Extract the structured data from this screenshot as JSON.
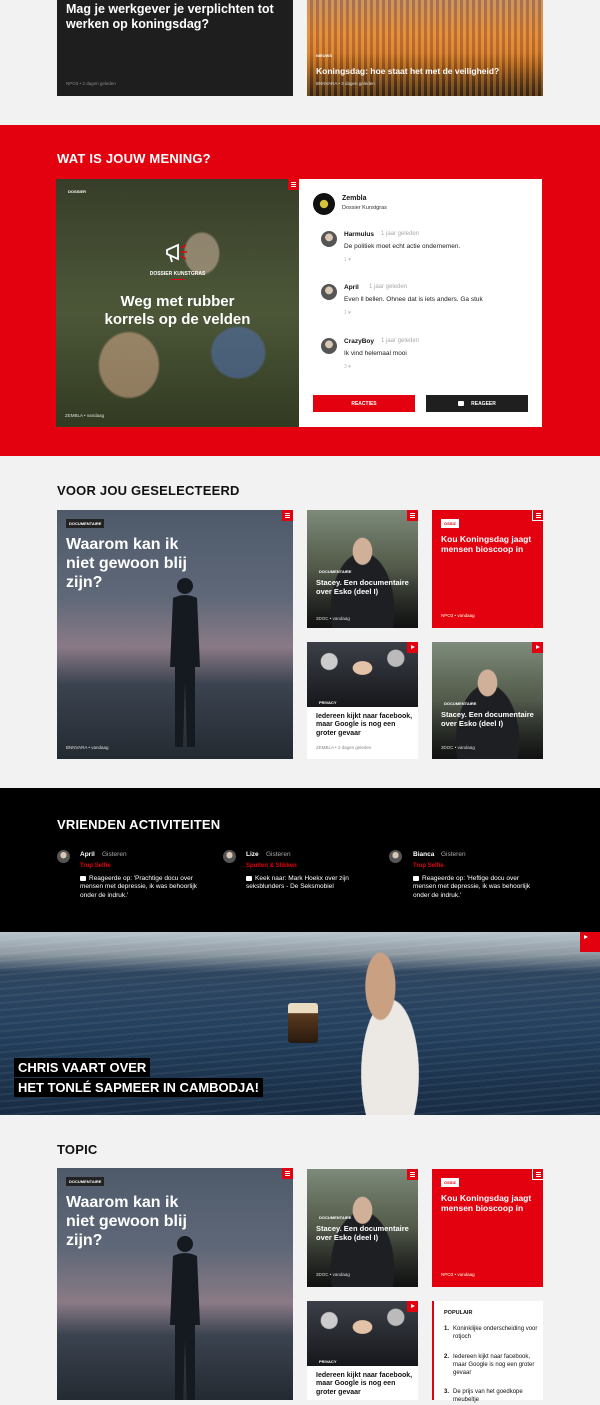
{
  "top": {
    "card1": {
      "title": "Mag je werkgever je verplichten tot werken op koningsdag?",
      "meta": "NPO3 • 2 dagen geleden"
    },
    "card2": {
      "badge": "NIEUWS",
      "title": "Koningsdag: hoe staat het met de veiligheid?",
      "meta": "BNNVARA • 3 dagen geleden"
    }
  },
  "opinion": {
    "heading": "WAT IS JOUW MENING?",
    "feature": {
      "badge": "DOSSIER",
      "kicker": "DOSSIER KUNSTGRAS",
      "title": "Weg met rubber korrels op de velden",
      "meta": "ZEMBLA • vandaag"
    },
    "panel": {
      "name": "Zembla",
      "sub": "Dossier Kunstgras"
    },
    "comments": [
      {
        "name": "Harmulus",
        "time": "1 jaar geleden",
        "text": "De politiek moet echt actie ondernemen.",
        "likes": "1 ♥"
      },
      {
        "name": "April",
        "time": "1 jaar geleden",
        "text": "Even ll bellen. Ohnee dat is iets anders. Ga stuk",
        "likes": "1 ♥"
      },
      {
        "name": "CrazyBoy",
        "time": "1 jaar geleden",
        "text": "Ik vind helemaal mooi",
        "likes": "3 ♥"
      }
    ],
    "btn_reacties": "REACTIES",
    "btn_reageer": "REAGEER"
  },
  "selected": {
    "heading": "VOOR JOU GESELECTEERD",
    "big": {
      "badge": "DOCUMENTAIRE",
      "title": "Waarom kan ik niet gewoon blij zijn?",
      "meta": "BNNVARA • vandaag"
    },
    "stacey1": {
      "badge": "DOCUMENTAIRE",
      "title": "Stacey. Een documentaire over Esko (deel I)",
      "meta": "3DOC • vandaag"
    },
    "kou": {
      "badge": "OSSIZ",
      "title": "Kou Koningsdag jaagt mensen bioscoop in",
      "meta": "NPO3 • vandaag"
    },
    "fb": {
      "badge": "PRIVACY",
      "title": "Iedereen kijkt naar facebook, maar Google is nog een groter gevaar",
      "meta": "ZEMBLA • 2 dagen geleden"
    },
    "stacey2": {
      "badge": "DOCUMENTAIRE",
      "title": "Stacey. Een documentaire over Esko (deel I)",
      "meta": "3DOC • vandaag"
    }
  },
  "friends": {
    "heading": "VRIENDEN ACTIVITEITEN",
    "items": [
      {
        "name": "April",
        "time": "Gisteren",
        "tag": "Trup Selfie",
        "text": "Reageerde op: 'Prachtige docu over mensen met depressie, ik was behoorlijk onder de indruk.'"
      },
      {
        "name": "Lize",
        "time": "Gisteren",
        "tag": "Spuiten & Slikken",
        "text": "Keek naar: Mark Hoekx over zijn seksblunders - De Seksmobiel"
      },
      {
        "name": "Bianca",
        "time": "Gisteren",
        "tag": "Trup Selfie",
        "text": "Reageerde op: 'Heftige docu over mensen met depressie, ik was behoorlijk onder de indruk.'"
      }
    ]
  },
  "hero": {
    "line1": "CHRIS VAART OVER",
    "line2": "HET TONLÉ SAPMEER IN CAMBODJA!"
  },
  "topic": {
    "heading": "TOPIC",
    "big": {
      "badge": "DOCUMENTAIRE",
      "title": "Waarom kan ik niet gewoon blij zijn?"
    },
    "stacey": {
      "badge": "DOCUMENTAIRE",
      "title": "Stacey. Een documentaire over Esko (deel I)",
      "meta": "3DOC • vandaag"
    },
    "kou": {
      "badge": "OSSIZ",
      "title": "Kou Koningsdag jaagt mensen bioscoop in",
      "meta": "NPO3 • vandaag"
    },
    "fb": {
      "badge": "PRIVACY",
      "title": "Iedereen kijkt naar facebook, maar Google is nog een groter gevaar"
    },
    "popular": {
      "heading": "POPULAIR",
      "items": [
        "Koninklijke onderscheiding voor rotjoch",
        "Iedereen kijkt naar facebook, maar Google is nog een groter gevaar",
        "De prijs van het goedkope meubeltje"
      ],
      "nums": [
        "1.",
        "2.",
        "3."
      ]
    }
  },
  "colors": {
    "accent": "#e3000f",
    "dark": "#000000"
  }
}
